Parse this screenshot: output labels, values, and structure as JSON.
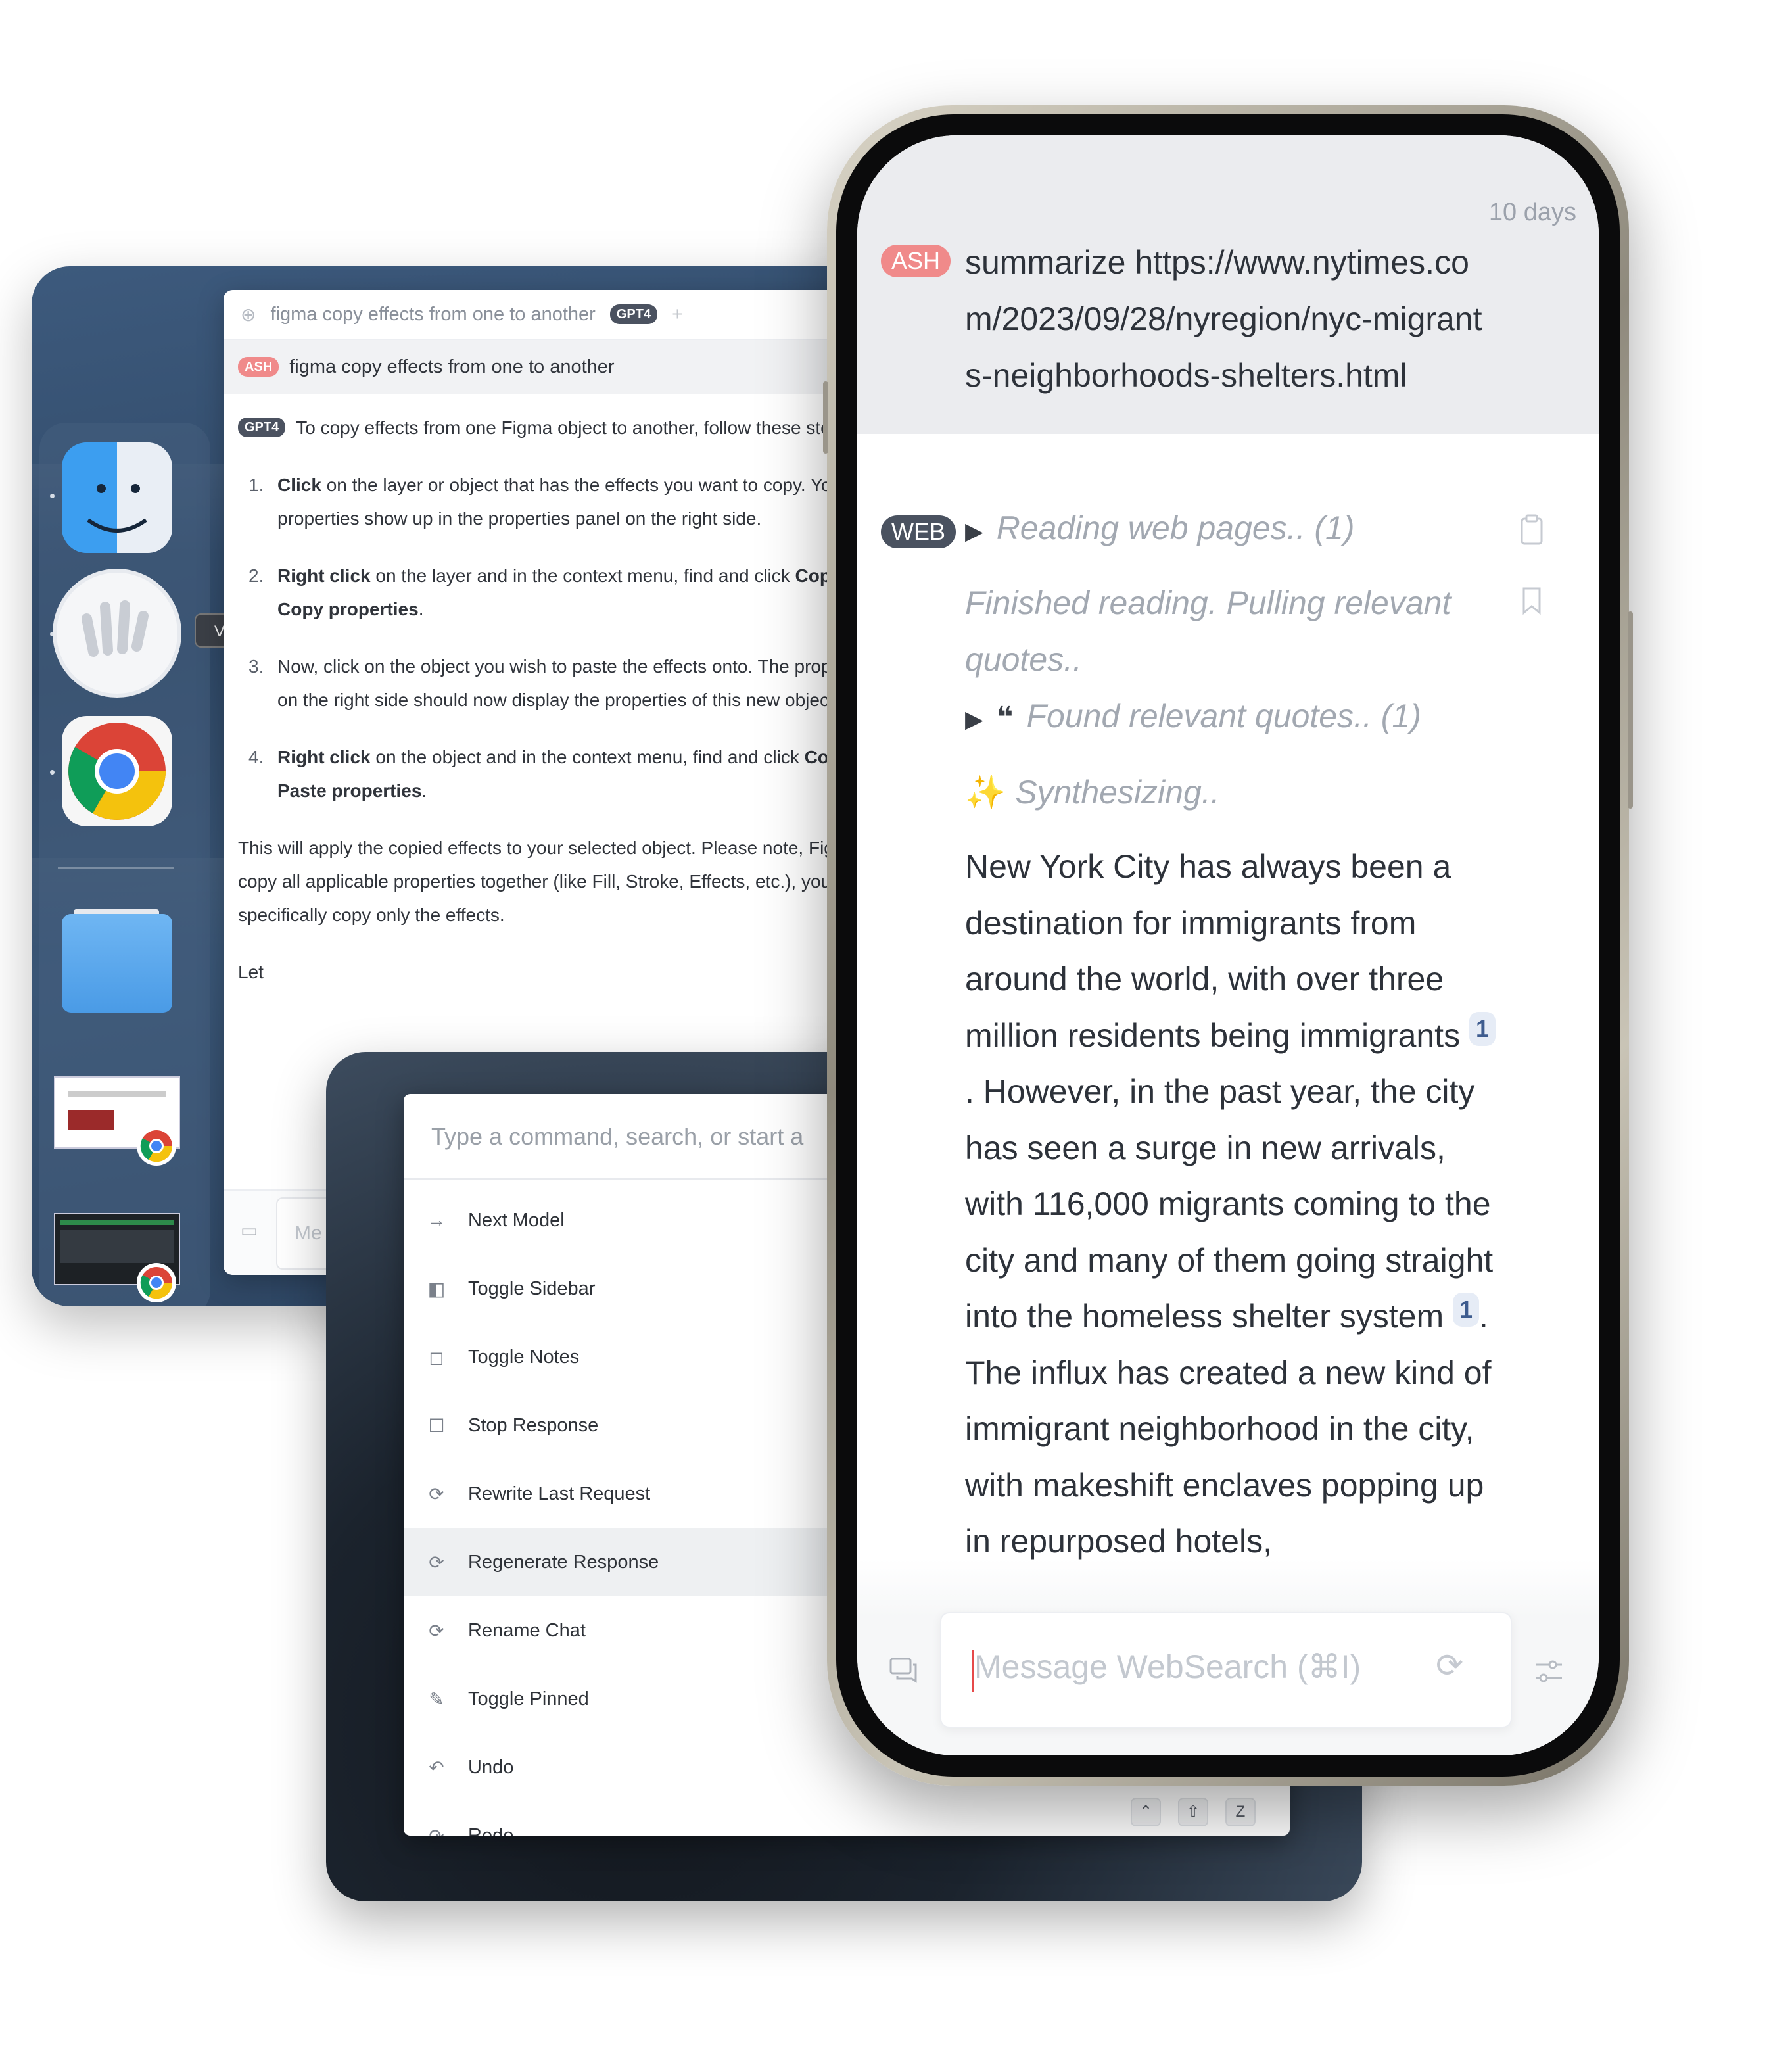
{
  "desktop": {
    "tooltip": "Vello",
    "chat": {
      "title": "figma copy effects from one to another",
      "model_badge": "GPT4",
      "user_badge": "ASH",
      "user_message": "figma copy effects from one to another",
      "assistant_badge": "GPT4",
      "intro": "To copy effects from one Figma object to another, follow these steps:",
      "steps": [
        {
          "num": "1.",
          "bold": "Click",
          "text": " on the layer or object that has the effects you want to copy. You will see its properties show up in the properties panel on the right side."
        },
        {
          "num": "2.",
          "bold": "Right click",
          "text": " on the layer and in the context menu, find and click ",
          "bold2": "Copy/Paste > Copy properties",
          "tail": "."
        },
        {
          "num": "3.",
          "bold": "",
          "text": "Now, click on the object you wish to paste the effects onto. The properties panel on the right side should now display the properties of this new object."
        },
        {
          "num": "4.",
          "bold": "Right click",
          "text": " on the object and in the context menu, find and click ",
          "bold2": "Copy/Paste > Paste properties",
          "tail": "."
        }
      ],
      "outro": "This will apply the copied effects to your selected object. Please note, Figma would copy all applicable properties together (like Fill, Stroke, Effects, etc.), you can not specifically copy only the effects.",
      "trailing": "Let",
      "input_placeholder": "Me"
    }
  },
  "palette": {
    "placeholder": "Type a command, search, or start a",
    "commands": [
      {
        "label": "Next Model",
        "icon": "arrow-right-icon",
        "glyph": "→"
      },
      {
        "label": "Toggle Sidebar",
        "icon": "sidebar-icon",
        "glyph": "◧"
      },
      {
        "label": "Toggle Notes",
        "icon": "note-icon",
        "glyph": "◻"
      },
      {
        "label": "Stop Response",
        "icon": "stop-icon",
        "glyph": "☐"
      },
      {
        "label": "Rewrite Last Request",
        "icon": "refresh-icon",
        "glyph": "⟳"
      },
      {
        "label": "Regenerate Response",
        "icon": "regenerate-icon",
        "glyph": "⟳"
      },
      {
        "label": "Rename Chat",
        "icon": "rename-icon",
        "glyph": "⟳"
      },
      {
        "label": "Toggle Pinned",
        "icon": "pin-icon",
        "glyph": "✎"
      },
      {
        "label": "Undo",
        "icon": "undo-icon",
        "glyph": "↶"
      },
      {
        "label": "Redo",
        "icon": "redo-icon",
        "glyph": "↷"
      }
    ],
    "selected_index": 5,
    "shortcut_keys": [
      "⌃",
      "⇧",
      "Z"
    ]
  },
  "phone": {
    "age": "10 days",
    "user_badge": "ASH",
    "user_query": "summarize https://www.nytimes.com/2023/09/28/nyregion/nyc-migrants-neighborhoods-shelters.html",
    "web_badge": "WEB",
    "steps": {
      "reading": "Reading web pages.. (1)",
      "finished": "Finished reading. Pulling relevant quotes..",
      "quotes": "Found relevant quotes.. (1)",
      "synth": "Synthesizing.."
    },
    "answer": {
      "p1": "New York City has always been a destination for immigrants from around the world, with over three million residents being immigrants ",
      "cite1": "1",
      "p2": ". However, in the past year, the city has seen a surge in new arrivals, with 116,000 migrants coming to the city and many of them going straight into the homeless shelter system ",
      "cite2": "1",
      "p3": ". The influx has created a new kind of immigrant neighborhood in the city, with makeshift enclaves popping up in repurposed hotels,"
    },
    "input_placeholder": "Message WebSearch (⌘I)"
  },
  "colors": {
    "ash_badge": "#f08a8a",
    "web_badge": "#4a5260",
    "citation_bg": "#e6ecf6",
    "caret": "#e64a4a"
  }
}
